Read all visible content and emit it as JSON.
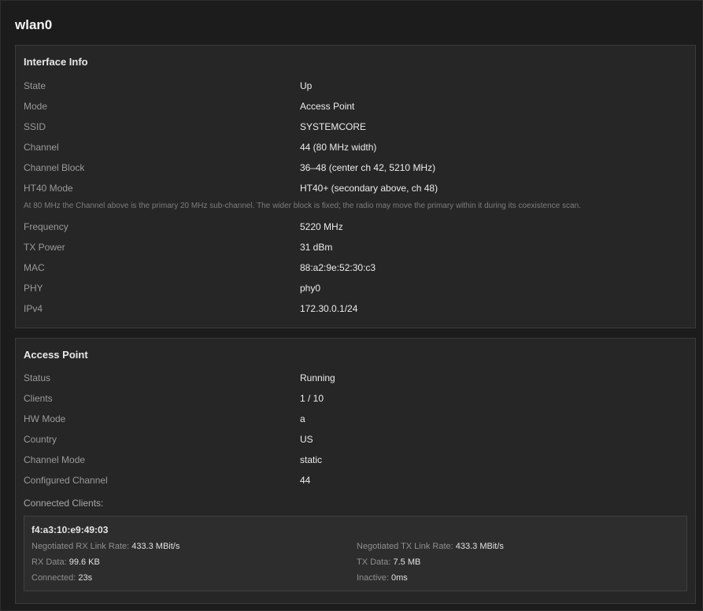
{
  "page": {
    "title": "wlan0"
  },
  "interface_info": {
    "title": "Interface Info",
    "rows_top": [
      {
        "label": "State",
        "value": "Up"
      },
      {
        "label": "Mode",
        "value": "Access Point"
      },
      {
        "label": "SSID",
        "value": "SYSTEMCORE"
      },
      {
        "label": "Channel",
        "value": "44 (80 MHz width)"
      },
      {
        "label": "Channel Block",
        "value": "36–48 (center ch 42, 5210 MHz)"
      },
      {
        "label": "HT40 Mode",
        "value": "HT40+ (secondary above, ch 48)"
      }
    ],
    "note": "At 80 MHz the Channel above is the primary 20 MHz sub-channel. The wider block is fixed; the radio may move the primary within it during its coexistence scan.",
    "rows_bottom": [
      {
        "label": "Frequency",
        "value": "5220 MHz"
      },
      {
        "label": "TX Power",
        "value": "31 dBm"
      },
      {
        "label": "MAC",
        "value": "88:a2:9e:52:30:c3"
      },
      {
        "label": "PHY",
        "value": "phy0"
      },
      {
        "label": "IPv4",
        "value": "172.30.0.1/24"
      }
    ]
  },
  "access_point": {
    "title": "Access Point",
    "rows": [
      {
        "label": "Status",
        "value": "Running"
      },
      {
        "label": "Clients",
        "value": "1 / 10"
      },
      {
        "label": "HW Mode",
        "value": "a"
      },
      {
        "label": "Country",
        "value": "US"
      },
      {
        "label": "Channel Mode",
        "value": "static"
      },
      {
        "label": "Configured Channel",
        "value": "44"
      }
    ],
    "connected_clients_label": "Connected Clients:",
    "clients": [
      {
        "mac": "f4:a3:10:e9:49:03",
        "rx_rate_label": "Negotiated RX Link Rate:",
        "rx_rate": "433.3 MBit/s",
        "tx_rate_label": "Negotiated TX Link Rate:",
        "tx_rate": "433.3 MBit/s",
        "rx_data_label": "RX Data:",
        "rx_data": "99.6 KB",
        "tx_data_label": "TX Data:",
        "tx_data": "7.5 MB",
        "connected_label": "Connected:",
        "connected": "23s",
        "inactive_label": "Inactive:",
        "inactive": "0ms"
      }
    ]
  }
}
